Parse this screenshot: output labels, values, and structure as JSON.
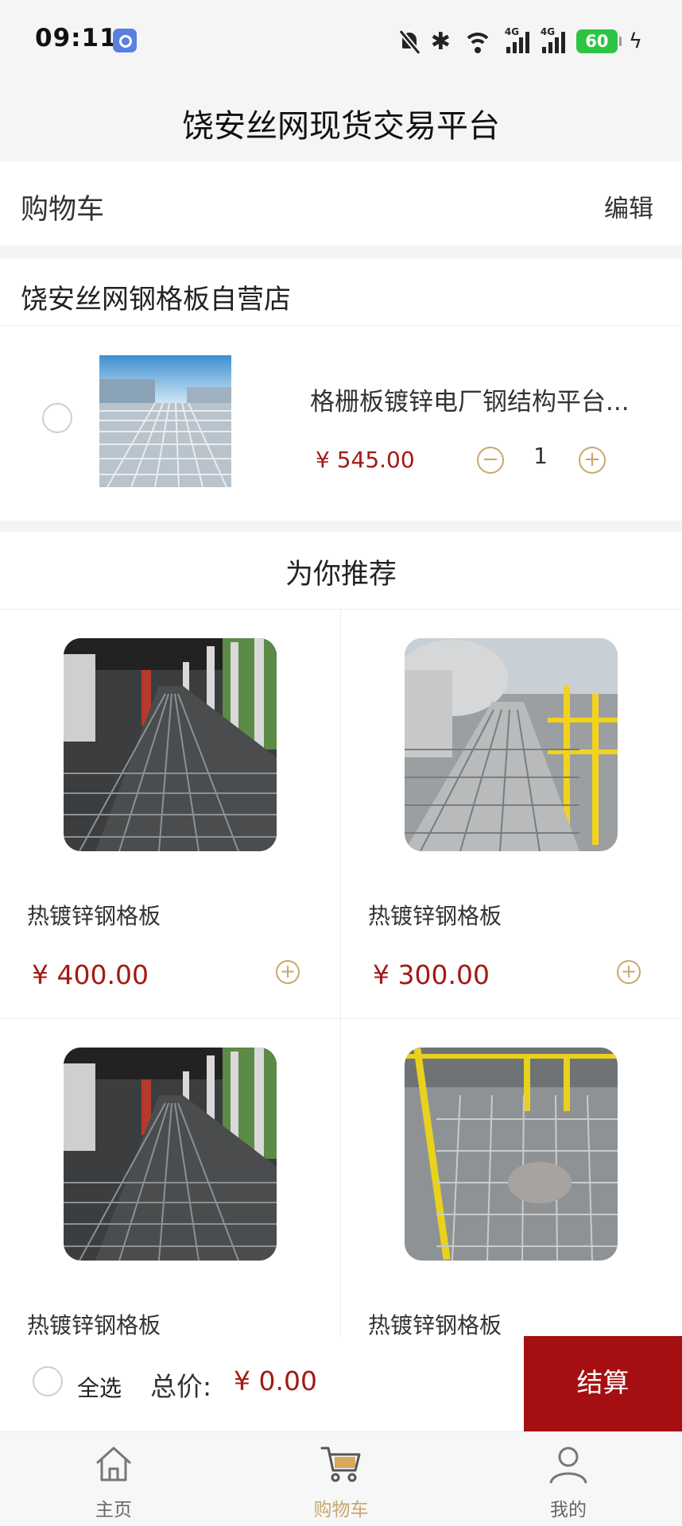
{
  "status_bar": {
    "time": "09:11",
    "battery": "60"
  },
  "nav": {
    "title": "饶安丝网现货交易平台"
  },
  "cart": {
    "title": "购物车",
    "edit_label": "编辑"
  },
  "store": {
    "name": "饶安丝网钢格板自营店",
    "item": {
      "name": "格栅板镀锌电厂钢结构平台...",
      "price": "¥ 545.00",
      "quantity": "1"
    }
  },
  "recommend": {
    "title": "为你推荐",
    "products": [
      {
        "name": "热镀锌钢格板",
        "price": "¥ 400.00"
      },
      {
        "name": "热镀锌钢格板",
        "price": "¥ 300.00"
      },
      {
        "name": "热镀锌钢格板",
        "price": ""
      },
      {
        "name": "热镀锌钢格板",
        "price": ""
      }
    ]
  },
  "checkout": {
    "select_all": "全选",
    "total_label": "总价:",
    "total_value": "¥ 0.00",
    "button_label": "结算"
  },
  "tabs": [
    {
      "label": "主页",
      "icon": "home-icon",
      "active": false
    },
    {
      "label": "购物车",
      "icon": "cart-icon",
      "active": true
    },
    {
      "label": "我的",
      "icon": "person-icon",
      "active": false
    }
  ],
  "colors": {
    "price": "#a21a14",
    "checkout_button": "#a50f12",
    "accent_gold": "#c9a76c",
    "battery": "#2ec443"
  }
}
